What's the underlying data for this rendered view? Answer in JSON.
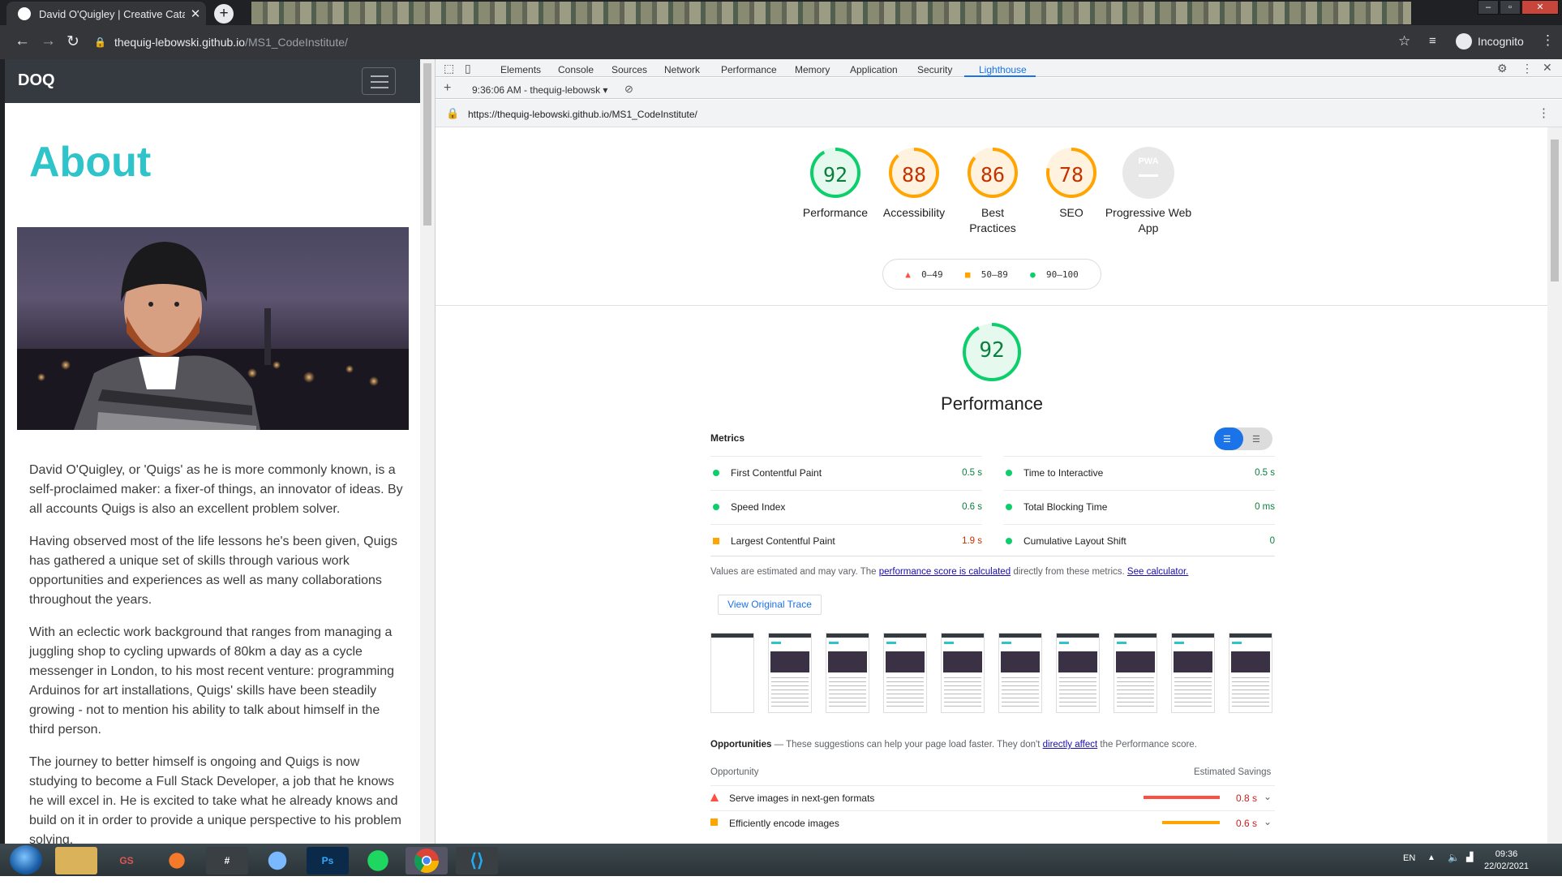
{
  "browser": {
    "tab_title": "David O'Quigley | Creative Cataly",
    "new_tab": "+",
    "url_host": "thequig-lebowski.github.io",
    "url_path": "/MS1_CodeInstitute/",
    "profile": "Incognito",
    "back": "←",
    "forward": "→",
    "reload": "↻"
  },
  "site": {
    "brand": "DOQ",
    "heading": "About",
    "paragraphs": [
      "David O'Quigley, or 'Quigs' as he is more commonly known, is a self-proclaimed maker: a fixer-of things, an innovator of ideas. By all accounts Quigs is also an excellent problem solver.",
      "Having observed most of the life lessons he's been given, Quigs has gathered a unique set of skills through various work opportunities and experiences as well as many collaborations throughout the years.",
      "With an eclectic work background that ranges from managing a juggling shop to cycling upwards of 80km a day as a cycle messenger in London, to his most recent venture: programming Arduinos for art installations, Quigs' skills have been steadily growing - not to mention his ability to talk about himself in the third person.",
      "The journey to better himself is ongoing and Quigs is now studying to become a Full Stack Developer, a job that he knows he will excel in. He is excited to take what he already knows and build on it in order to provide a unique perspective to his problem solving."
    ]
  },
  "devtools": {
    "tabs": [
      "Elements",
      "Console",
      "Sources",
      "Network",
      "Performance",
      "Memory",
      "Application",
      "Security",
      "Lighthouse"
    ],
    "active_tab": "Lighthouse",
    "report_select": "9:36:06 AM - thequig-lebowsk",
    "report_url": "https://thequig-lebowski.github.io/MS1_CodeInstitute/"
  },
  "lighthouse": {
    "gauges": [
      {
        "label": "Performance",
        "score": 92,
        "color": "#0cce6b",
        "text": "#0c7e3e",
        "bg": "#e6f9ee"
      },
      {
        "label": "Accessibility",
        "score": 88,
        "color": "#ffa400",
        "text": "#c33300",
        "bg": "#fff3e0"
      },
      {
        "label": "Best Practices",
        "score": 86,
        "color": "#ffa400",
        "text": "#c33300",
        "bg": "#fff3e0"
      },
      {
        "label": "SEO",
        "score": 78,
        "color": "#ffa400",
        "text": "#c33300",
        "bg": "#fff3e0"
      }
    ],
    "pwa_label": "Progressive Web App",
    "pwa_badge": "PWA",
    "legend": [
      "0–49",
      "50–89",
      "90–100"
    ],
    "perf_score": "92",
    "perf_title": "Performance",
    "metrics_title": "Metrics",
    "metrics": [
      {
        "name": "First Contentful Paint",
        "value": "0.5 s",
        "status": "pass"
      },
      {
        "name": "Time to Interactive",
        "value": "0.5 s",
        "status": "pass"
      },
      {
        "name": "Speed Index",
        "value": "0.6 s",
        "status": "pass"
      },
      {
        "name": "Total Blocking Time",
        "value": "0 ms",
        "status": "pass"
      },
      {
        "name": "Largest Contentful Paint",
        "value": "1.9 s",
        "status": "average"
      },
      {
        "name": "Cumulative Layout Shift",
        "value": "0",
        "status": "pass"
      }
    ],
    "estimate_text": "Values are estimated and may vary. The",
    "estimate_link": "performance score is calculated",
    "estimate_text2": "directly from these metrics.",
    "estimate_link2": "See calculator.",
    "view_trace": "View Original Trace",
    "thumbnail_count": 10,
    "opportunities_title": "Opportunities",
    "opportunities_text": "— These suggestions can help your page load faster. They don't",
    "opportunities_link": "directly affect",
    "opportunities_text2": "the Performance score.",
    "opp_col": "Opportunity",
    "savings_col": "Estimated Savings",
    "opportunities": [
      {
        "name": "Serve images in next-gen formats",
        "savings": "0.8 s",
        "status": "fail",
        "share": 1.0
      },
      {
        "name": "Efficiently encode images",
        "savings": "0.6 s",
        "status": "average",
        "share": 0.76
      }
    ]
  },
  "taskbar": {
    "language": "EN",
    "time": "09:36",
    "date": "22/02/2021",
    "apps": [
      "explorer",
      "gs",
      "blender",
      "slack",
      "itunes",
      "Ps",
      "spotify",
      "chrome",
      "vscode"
    ]
  },
  "colors": {
    "pass": "#0cce6b",
    "average": "#ffa400",
    "fail": "#ff4e42",
    "teal": "#2ec4c9"
  }
}
